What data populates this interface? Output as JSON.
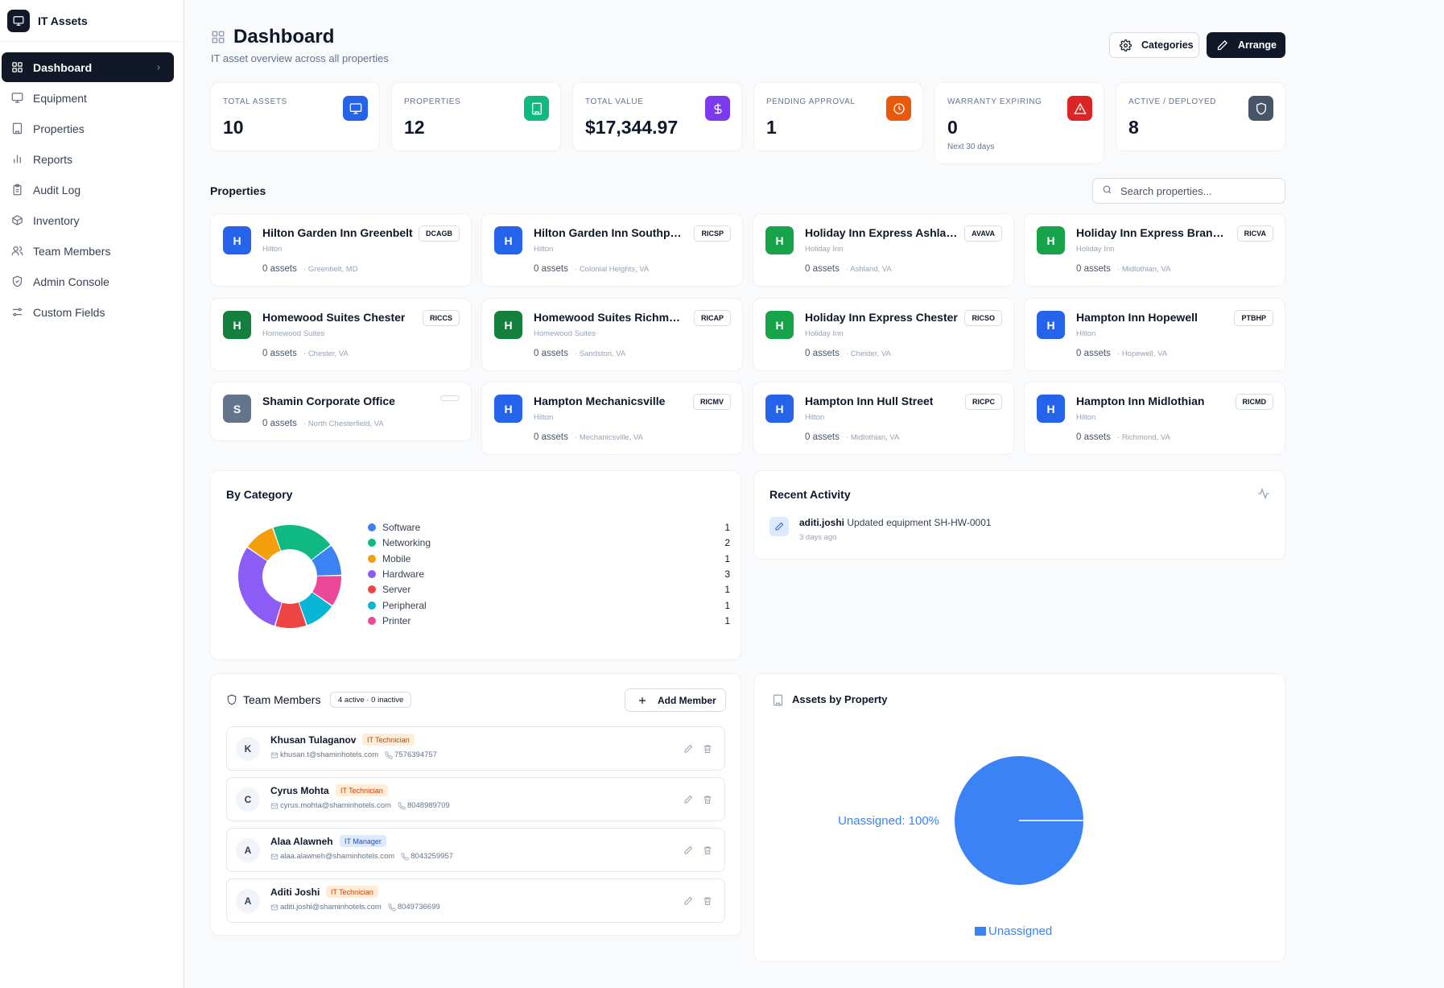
{
  "app": {
    "name": "IT Assets"
  },
  "sidebar": {
    "items": [
      {
        "label": "Dashboard",
        "icon": "dashboard-icon"
      },
      {
        "label": "Equipment",
        "icon": "monitor-icon"
      },
      {
        "label": "Properties",
        "icon": "building-icon"
      },
      {
        "label": "Reports",
        "icon": "bar-chart-icon"
      },
      {
        "label": "Audit Log",
        "icon": "clipboard-icon"
      },
      {
        "label": "Inventory",
        "icon": "package-icon"
      },
      {
        "label": "Team Members",
        "icon": "users-icon"
      },
      {
        "label": "Admin Console",
        "icon": "shield-check-icon"
      },
      {
        "label": "Custom Fields",
        "icon": "sliders-icon"
      }
    ]
  },
  "header": {
    "title": "Dashboard",
    "subtitle": "IT asset overview across all properties",
    "categories_label": "Categories",
    "arrange_label": "Arrange"
  },
  "stats": [
    {
      "label": "Total Assets",
      "value": "10",
      "note": "",
      "icon": "monitor-icon",
      "color": "#2563eb"
    },
    {
      "label": "Properties",
      "value": "12",
      "note": "",
      "icon": "building-icon",
      "color": "#10b981"
    },
    {
      "label": "Total Value",
      "value": "$17,344.97",
      "note": "",
      "icon": "dollar-icon",
      "color": "#7c3aed"
    },
    {
      "label": "Pending Approval",
      "value": "1",
      "note": "",
      "icon": "clock-icon",
      "color": "#ea580c"
    },
    {
      "label": "Warranty Expiring",
      "value": "0",
      "note": "Next 30 days",
      "icon": "alert-triangle-icon",
      "color": "#dc2626"
    },
    {
      "label": "Active / Deployed",
      "value": "8",
      "note": "",
      "icon": "shield-icon",
      "color": "#475569"
    }
  ],
  "properties": {
    "title": "Properties",
    "search_placeholder": "Search properties...",
    "items": [
      {
        "initial": "H",
        "name": "Hilton Garden Inn Greenbelt",
        "brand": "Hilton",
        "code": "DCAGB",
        "assets": "0 assets",
        "location": "Greenbelt, MD",
        "color": "#2563eb"
      },
      {
        "initial": "H",
        "name": "Hilton Garden Inn Southpark",
        "brand": "Hilton",
        "code": "RICSP",
        "assets": "0 assets",
        "location": "Colonial Heights, VA",
        "color": "#2563eb"
      },
      {
        "initial": "H",
        "name": "Holiday Inn Express Ashland",
        "brand": "Holiday Inn",
        "code": "AVAVA",
        "assets": "0 assets",
        "location": "Ashland, VA",
        "color": "#16a34a"
      },
      {
        "initial": "H",
        "name": "Holiday Inn Express Brander...",
        "brand": "Holiday Inn",
        "code": "RICVA",
        "assets": "0 assets",
        "location": "Midlothian, VA",
        "color": "#16a34a"
      },
      {
        "initial": "H",
        "name": "Homewood Suites Chester",
        "brand": "Homewood Suites",
        "code": "RICCS",
        "assets": "0 assets",
        "location": "Chester, VA",
        "color": "#15803d"
      },
      {
        "initial": "H",
        "name": "Homewood Suites Richmon...",
        "brand": "Homewood Suites",
        "code": "RICAP",
        "assets": "0 assets",
        "location": "Sandston, VA",
        "color": "#15803d"
      },
      {
        "initial": "H",
        "name": "Holiday Inn Express Chester",
        "brand": "Holiday Inn",
        "code": "RICSO",
        "assets": "0 assets",
        "location": "Chester, VA",
        "color": "#16a34a"
      },
      {
        "initial": "H",
        "name": "Hampton Inn Hopewell",
        "brand": "Hilton",
        "code": "PTBHP",
        "assets": "0 assets",
        "location": "Hopewell, VA",
        "color": "#2563eb"
      },
      {
        "initial": "S",
        "name": "Shamin Corporate Office",
        "brand": "",
        "code": "",
        "assets": "0 assets",
        "location": "North Chesterfield, VA",
        "color": "#64748b"
      },
      {
        "initial": "H",
        "name": "Hampton Mechanicsville",
        "brand": "Hilton",
        "code": "RICMV",
        "assets": "0 assets",
        "location": "Mechanicsville, VA",
        "color": "#2563eb"
      },
      {
        "initial": "H",
        "name": "Hampton Inn Hull Street",
        "brand": "Hilton",
        "code": "RICPC",
        "assets": "0 assets",
        "location": "Midlothian, VA",
        "color": "#2563eb"
      },
      {
        "initial": "H",
        "name": "Hampton Inn Midlothian",
        "brand": "Hilton",
        "code": "RICMD",
        "assets": "0 assets",
        "location": "Richmond, VA",
        "color": "#2563eb"
      }
    ]
  },
  "by_category": {
    "title": "By Category",
    "items": [
      {
        "name": "Software",
        "count": "1",
        "color": "#3b82f6"
      },
      {
        "name": "Networking",
        "count": "2",
        "color": "#10b981"
      },
      {
        "name": "Mobile",
        "count": "1",
        "color": "#f59e0b"
      },
      {
        "name": "Hardware",
        "count": "3",
        "color": "#8b5cf6"
      },
      {
        "name": "Server",
        "count": "1",
        "color": "#ef4444"
      },
      {
        "name": "Peripheral",
        "count": "1",
        "color": "#06b6d4"
      },
      {
        "name": "Printer",
        "count": "1",
        "color": "#ec4899"
      }
    ]
  },
  "recent_activity": {
    "title": "Recent Activity",
    "items": [
      {
        "user": "aditi.joshi",
        "action": "Updated equipment SH-HW-0001",
        "time": "3 days ago"
      }
    ]
  },
  "team": {
    "title": "Team Members",
    "badge": "4 active · 0 inactive",
    "add_label": "Add Member",
    "members": [
      {
        "initial": "K",
        "name": "Khusan Tulaganov",
        "role": "IT Technician",
        "role_type": "tech",
        "email": "khusan.t@shaminhotels.com",
        "phone": "7576394757"
      },
      {
        "initial": "C",
        "name": "Cyrus Mohta",
        "role": "IT Technician",
        "role_type": "tech",
        "email": "cyrus.mohta@shaminhotels.com",
        "phone": "8048989709"
      },
      {
        "initial": "A",
        "name": "Alaa Alawneh",
        "role": "IT Manager",
        "role_type": "mgr",
        "email": "alaa.alawneh@shaminhotels.com",
        "phone": "8043259957"
      },
      {
        "initial": "A",
        "name": "Aditi Joshi",
        "role": "IT Technician",
        "role_type": "tech",
        "email": "aditi.joshi@shaminhotels.com",
        "phone": "8049736699"
      }
    ]
  },
  "chart_data": [
    {
      "type": "pie",
      "title": "By Category",
      "categories": [
        "Software",
        "Networking",
        "Mobile",
        "Hardware",
        "Server",
        "Peripheral",
        "Printer"
      ],
      "values": [
        1,
        2,
        1,
        3,
        1,
        1,
        1
      ],
      "colors": [
        "#3b82f6",
        "#10b981",
        "#f59e0b",
        "#8b5cf6",
        "#ef4444",
        "#06b6d4",
        "#ec4899"
      ]
    },
    {
      "type": "pie",
      "title": "Assets by Property",
      "categories": [
        "Unassigned"
      ],
      "values": [
        100
      ],
      "data_label": "Unassigned: 100%",
      "legend": "Unassigned",
      "color": "#3b82f6"
    }
  ]
}
